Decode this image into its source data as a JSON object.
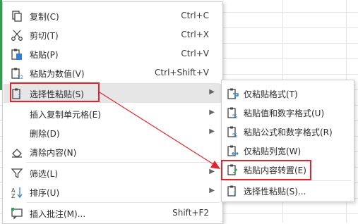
{
  "context_menu": {
    "items": [
      {
        "label": "复制(C)",
        "shortcut": "Ctrl+C",
        "icon": "copy-icon"
      },
      {
        "label": "剪切(T)",
        "shortcut": "Ctrl+X",
        "icon": "scissors-icon"
      },
      {
        "label": "粘贴(P)",
        "shortcut": "Ctrl+V",
        "icon": "paste-icon"
      },
      {
        "label": "粘贴为数值(V)",
        "shortcut": "Ctrl+Shift+V",
        "icon": "paste-values-icon"
      },
      {
        "label": "选择性粘贴(S)",
        "icon": "paste-special-icon"
      },
      {
        "label": "插入复制单元格(E)"
      },
      {
        "label": "删除(D)"
      },
      {
        "label": "清除内容(N)",
        "icon": "eraser-icon"
      },
      {
        "label": "筛选(L)",
        "icon": "filter-icon"
      },
      {
        "label": "排序(U)",
        "icon": "sort-icon"
      },
      {
        "label": "插入批注(M)...",
        "shortcut": "Shift+F2",
        "icon": "comment-icon"
      }
    ]
  },
  "paste_submenu": {
    "items": [
      {
        "label": "仅粘贴格式(T)",
        "icon": "paste-format-icon"
      },
      {
        "label": "粘贴值和数字格式(U)",
        "icon": "paste-values-number-format-icon"
      },
      {
        "label": "粘贴公式和数字格式(R)",
        "icon": "paste-formula-number-format-icon"
      },
      {
        "label": "仅粘贴列宽(W)",
        "icon": "paste-column-width-icon"
      },
      {
        "label": "粘贴内容转置(E)",
        "icon": "paste-transpose-icon"
      },
      {
        "label": "选择性粘贴(S)...",
        "icon": "paste-special-dialog-icon"
      }
    ]
  },
  "colors": {
    "highlight": "#e6e6e6",
    "annotation_red": "#e0232e",
    "accent_green": "#2da44e"
  }
}
